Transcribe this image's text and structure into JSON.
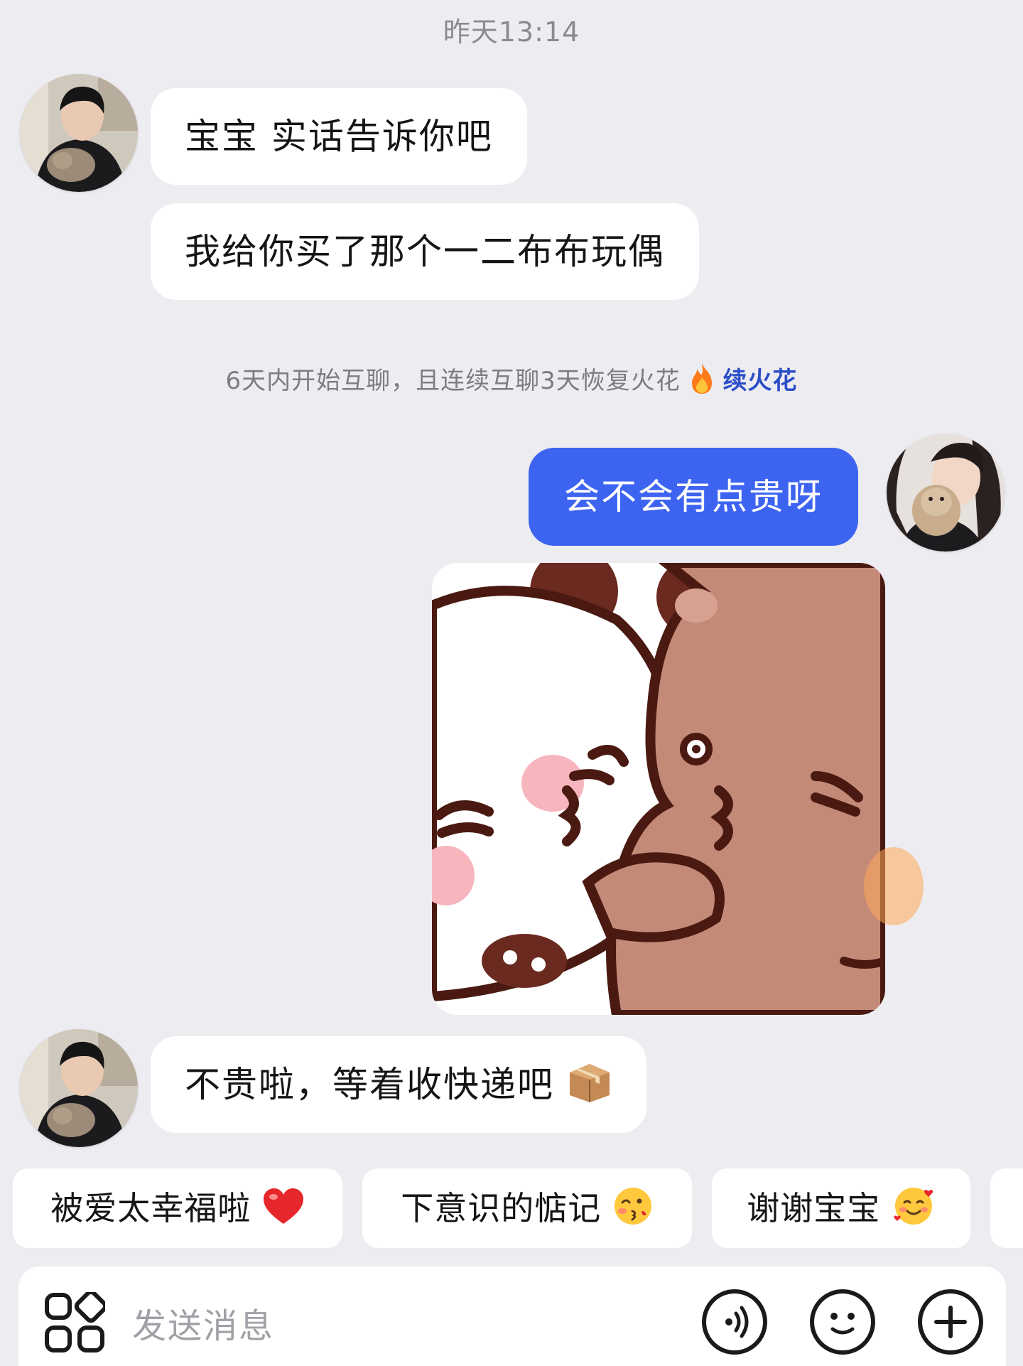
{
  "header": {
    "timestamp": "昨天13:14"
  },
  "messages": [
    {
      "side": "left",
      "text": "宝宝 实话告诉你吧"
    },
    {
      "side": "left",
      "text": "我给你买了那个一二布布玩偶"
    },
    {
      "side": "right",
      "text": "会不会有点贵呀"
    },
    {
      "side": "right",
      "type": "sticker",
      "sticker": "hugging-bears-kiss-sticker"
    },
    {
      "side": "left",
      "text": "不贵啦，等着收快递吧"
    }
  ],
  "system_notice": {
    "text": "6天内开始互聊，且连续互聊3天恢复火花",
    "link": "续火花"
  },
  "quick_replies": [
    {
      "text": "被爱太幸福啦"
    },
    {
      "text": "下意识的惦记"
    },
    {
      "text": "谢谢宝宝"
    }
  ],
  "composer": {
    "placeholder": "发送消息"
  },
  "icons": {
    "apps": "apps-grid-icon",
    "voice": "voice-icon",
    "emoji": "emoji-icon",
    "plus": "plus-icon",
    "fire": "fire-icon",
    "package": "package-emoji-icon",
    "heart": "red-heart-emoji-icon",
    "kiss": "kissing-face-emoji-icon",
    "hearts_face": "smiling-face-with-hearts-emoji-icon"
  },
  "colors": {
    "background": "#ededf1",
    "bubble_incoming": "#ffffff",
    "bubble_outgoing": "#3d64f1",
    "link": "#2d4ec8"
  }
}
